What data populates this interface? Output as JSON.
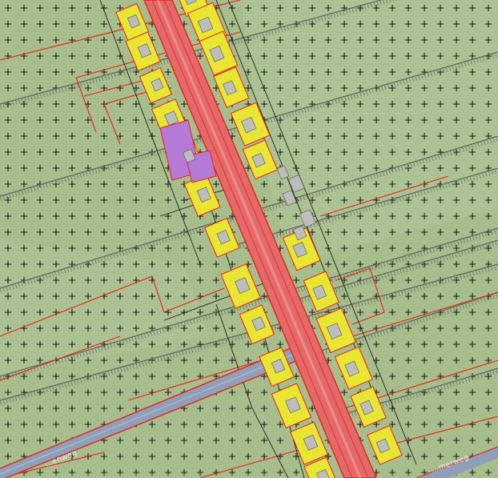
{
  "map": {
    "street_labels": [
      {
        "id": "street-label-left",
        "text": "…enweg"
      },
      {
        "id": "street-label-right",
        "text": "…merweg"
      }
    ],
    "colors": {
      "agriculture": "#a7bd8c",
      "agriculture_alt": "#b4c79a",
      "cross_symbol": "#1a1a1a",
      "plan_boundary": "#e8211b",
      "road_zone": "#e46a6a",
      "residential": "#e8e632",
      "residential_outline": "#e8211b",
      "society": "#b57ad6",
      "canal": "#8f9fb8",
      "canal_edge": "#e8211b",
      "building": "#b9b9b9",
      "parcel_line": "#222222",
      "ditch_hatch": "#6d7468"
    },
    "legend_classes": [
      "agriculture",
      "residential",
      "road",
      "society",
      "water"
    ]
  }
}
